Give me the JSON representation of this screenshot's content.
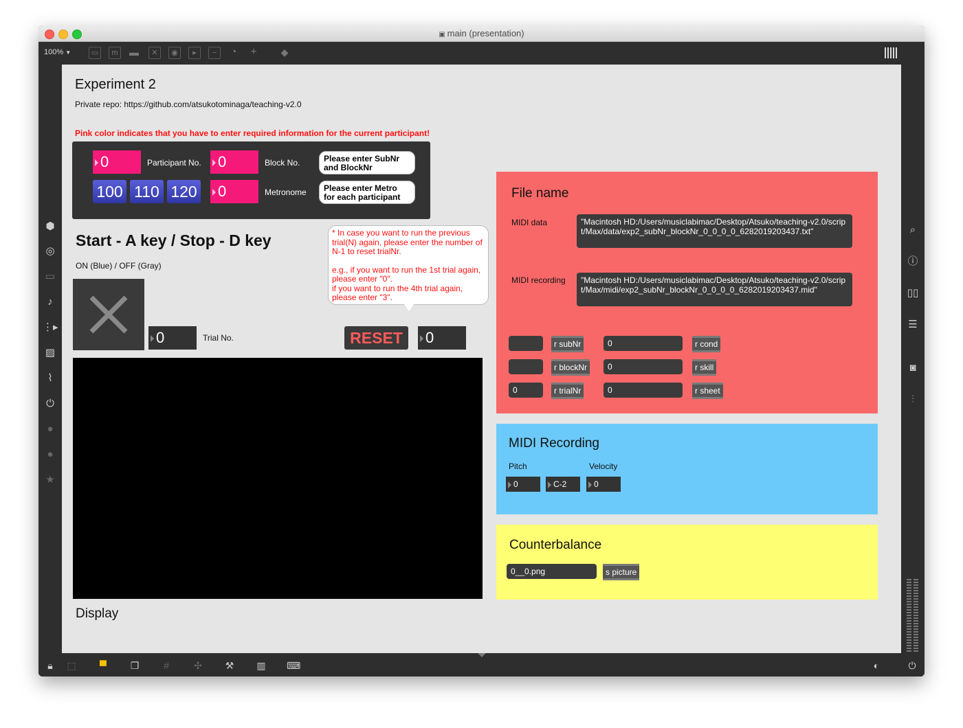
{
  "window": {
    "title": "main (presentation)",
    "zoom": "100%"
  },
  "header": {
    "title": "Experiment 2",
    "repo": "Private repo: https://github.com/atsukotominaga/teaching-v2.0",
    "warning": "Pink color indicates that you have to enter required information for the current participant!"
  },
  "participant_panel": {
    "participant_value": "0",
    "participant_label": "Participant No.",
    "block_value": "0",
    "block_label": "Block No.",
    "bubble_sub": "Please enter SubNr and BlockNr",
    "tempo_buttons": [
      "100",
      "110",
      "120"
    ],
    "metronome_value": "0",
    "metronome_label": "Metronome",
    "bubble_metro": "Please enter Metro for each participant"
  },
  "control": {
    "title": "Start - A key / Stop - D key",
    "onoff_label": "ON (Blue) / OFF (Gray)",
    "trial_value": "0",
    "trial_label": "Trial No.",
    "note_lines": [
      "* In case you want to run the previous trial(N) again, please enter the number of N-1 to reset trialNr.",
      "e.g., if you want to run the 1st trial again, please enter \"0\".",
      "if you want to run the 4th trial again, please enter \"3\"."
    ],
    "reset_label": "RESET",
    "reset_value": "0",
    "display_label": "Display"
  },
  "file_name": {
    "title": "File name",
    "midi_data_label": "MIDI data",
    "midi_data_path": "\"Macintosh HD:/Users/musiclabimac/Desktop/Atsuko/teaching-v2.0/script/Max/data/exp2_subNr_blockNr_0_0_0_0_6282019203437.txt\"",
    "midi_recording_label": "MIDI recording",
    "midi_recording_path": "\"Macintosh HD:/Users/musiclabimac/Desktop/Atsuko/teaching-v2.0/script/Max/midi/exp2_subNr_blockNr_0_0_0_0_6282019203437.mid\"",
    "rows": [
      {
        "left_value": "",
        "left_recv": "r subNr",
        "right_value": "0",
        "right_recv": "r cond"
      },
      {
        "left_value": "",
        "left_recv": "r blockNr",
        "right_value": "0",
        "right_recv": "r skill"
      },
      {
        "left_value": "0",
        "left_recv": "r trialNr",
        "right_value": "0",
        "right_recv": "r sheet"
      }
    ]
  },
  "midi_recording": {
    "title": "MIDI Recording",
    "pitch_label": "Pitch",
    "velocity_label": "Velocity",
    "pitch_value": "0",
    "note_value": "C-2",
    "velocity_value": "0"
  },
  "counterbalance": {
    "title": "Counterbalance",
    "file_value": "0__0.png",
    "send_label": "s picture"
  },
  "colors": {
    "pink": "#f5197a",
    "file_panel": "#f86868",
    "midi_panel": "#6ccafb",
    "counter_panel": "#ffff73",
    "reset_text": "#ff5a5a"
  }
}
